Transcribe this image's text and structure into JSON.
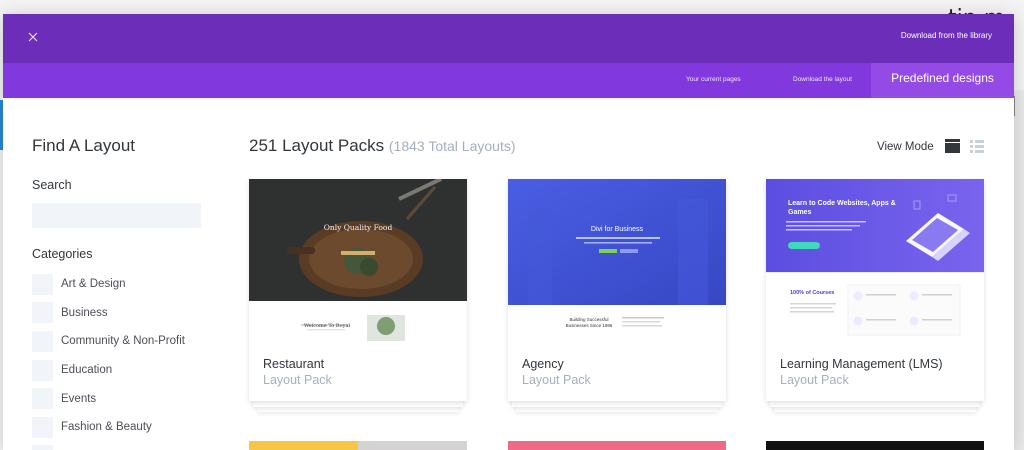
{
  "background_text": "tip m",
  "topbar": {
    "close_icon": "close-icon",
    "title": "Download from the library"
  },
  "tabs": [
    {
      "label": "Your current pages"
    },
    {
      "label": "Download the layout"
    },
    {
      "label": "Predefined designs",
      "active": true
    }
  ],
  "sidebar": {
    "title": "Find A Layout",
    "search_label": "Search",
    "search_placeholder": "",
    "categories_label": "Categories",
    "categories": [
      "Art & Design",
      "Business",
      "Community & Non-Profit",
      "Education",
      "Events",
      "Fashion & Beauty"
    ]
  },
  "main": {
    "title": "251 Layout Packs",
    "count": "(1843 Total Layouts)",
    "view_mode_label": "View Mode"
  },
  "cards": [
    {
      "name": "Restaurant",
      "sub": "Layout Pack",
      "thumb_heading": "Only Quality Food",
      "thumb_lower": "Welcome To Royal"
    },
    {
      "name": "Agency",
      "sub": "Layout Pack",
      "thumb_heading": "Divi for Business",
      "thumb_lower": "Building Successful Businesses Since 1986"
    },
    {
      "name": "Learning Management (LMS)",
      "sub": "Layout Pack",
      "thumb_heading": "Learn to Code Websites, Apps & Games",
      "thumb_lower": "100% of Courses"
    }
  ],
  "colors": {
    "topbar": "#6c2eb9",
    "tabbar": "#8139dd",
    "active_tab": "#944be6",
    "muted_text": "#a3b0bd",
    "agency_blue": "#3f51d6",
    "lms_purple": "#6b55e6"
  }
}
